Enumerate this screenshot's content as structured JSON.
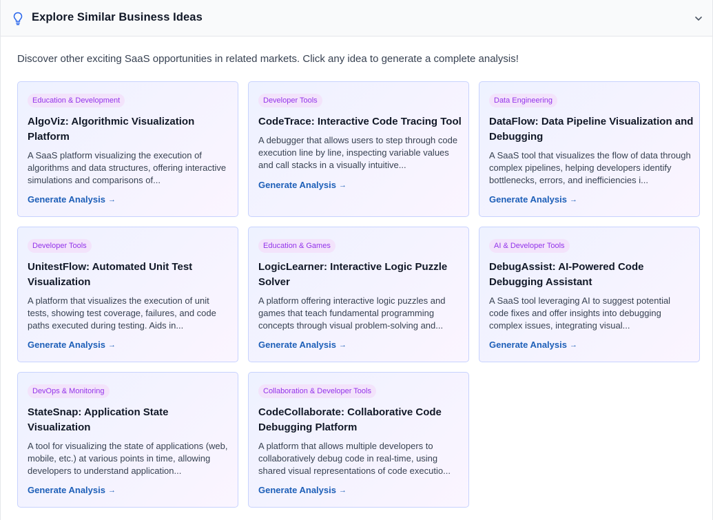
{
  "header": {
    "title": "Explore Similar Business Ideas"
  },
  "intro": "Discover other exciting SaaS opportunities in related markets. Click any idea to generate a complete analysis!",
  "cta_label": "Generate Analysis",
  "cta_arrow": "→",
  "colors": {
    "accent_link": "#1d5fb8",
    "badge_text": "#9333ea",
    "badge_bg": "#f3e3fb",
    "card_border": "#c7d2fe"
  },
  "ideas": [
    {
      "category": "Education & Development",
      "title": "AlgoViz: Algorithmic Visualization Platform",
      "description": "A SaaS platform visualizing the execution of algorithms and data structures, offering interactive simulations and comparisons of..."
    },
    {
      "category": "Developer Tools",
      "title": "CodeTrace: Interactive Code Tracing Tool",
      "description": "A debugger that allows users to step through code execution line by line, inspecting variable values and call stacks in a visually intuitive..."
    },
    {
      "category": "Data Engineering",
      "title": "DataFlow: Data Pipeline Visualization and Debugging",
      "description": "A SaaS tool that visualizes the flow of data through complex pipelines, helping developers identify bottlenecks, errors, and inefficiencies i..."
    },
    {
      "category": "Developer Tools",
      "title": "UnitestFlow: Automated Unit Test Visualization",
      "description": "A platform that visualizes the execution of unit tests, showing test coverage, failures, and code paths executed during testing. Aids in..."
    },
    {
      "category": "Education & Games",
      "title": "LogicLearner: Interactive Logic Puzzle Solver",
      "description": "A platform offering interactive logic puzzles and games that teach fundamental programming concepts through visual problem-solving and..."
    },
    {
      "category": "AI & Developer Tools",
      "title": "DebugAssist: AI-Powered Code Debugging Assistant",
      "description": "A SaaS tool leveraging AI to suggest potential code fixes and offer insights into debugging complex issues, integrating visual..."
    },
    {
      "category": "DevOps & Monitoring",
      "title": "StateSnap: Application State Visualization",
      "description": "A tool for visualizing the state of applications (web, mobile, etc.) at various points in time, allowing developers to understand application..."
    },
    {
      "category": "Collaboration & Developer Tools",
      "title": "CodeCollaborate: Collaborative Code Debugging Platform",
      "description": "A platform that allows multiple developers to collaboratively debug code in real-time, using shared visual representations of code executio..."
    }
  ]
}
